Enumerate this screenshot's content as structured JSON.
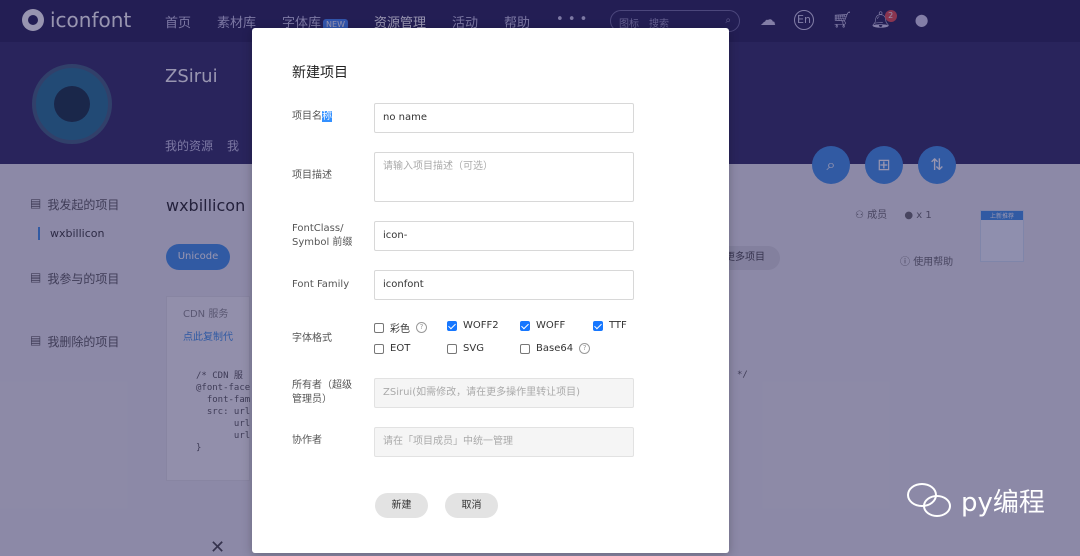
{
  "header": {
    "logo_text": "iconfont",
    "nav": [
      "首页",
      "素材库",
      "字体库",
      "资源管理",
      "活动",
      "帮助",
      "• • •"
    ],
    "nav_new_tag": "NEW",
    "search_scope": "图标",
    "search_placeholder": "搜索",
    "lang": "En",
    "notification_count": "2"
  },
  "hero": {
    "username": "ZSirui",
    "subnav": [
      "我的资源",
      "我"
    ]
  },
  "sidebar": {
    "items": [
      "我发起的项目",
      "我参与的项目",
      "我删除的项目"
    ],
    "current_project": "wxbillicon"
  },
  "main": {
    "project_title": "wxbillicon",
    "active_tab": "Unicode",
    "cdn_text": "CDN 服务",
    "cdn_link": "点此复制代",
    "code_lines": [
      "/* CDN 服",
      "@font-face",
      "  font-fam",
      "  src: url",
      "       url",
      "       url",
      "}"
    ],
    "code_end": "*/",
    "settings_button": "更多项目",
    "right_count": "x 1",
    "right_member": "成员",
    "help_link": "使用帮助",
    "right_card_tag": "上新推荐"
  },
  "modal": {
    "title": "新建项目",
    "name_label_plain": "项目名",
    "name_label_selected": "称",
    "name_value": "no name",
    "desc_label": "项目描述",
    "desc_placeholder": "请输入项目描述（可选）",
    "fontclass_label_line1": "FontClass/",
    "fontclass_label_line2": "Symbol 前缀",
    "fontclass_value": "icon-",
    "family_label": "Font Family",
    "family_value": "iconfont",
    "format_label": "字体格式",
    "formats": [
      {
        "label": "彩色",
        "checked": false,
        "help": true
      },
      {
        "label": "WOFF2",
        "checked": true,
        "help": false
      },
      {
        "label": "WOFF",
        "checked": true,
        "help": false
      },
      {
        "label": "TTF",
        "checked": true,
        "help": false
      },
      {
        "label": "EOT",
        "checked": false,
        "help": false
      },
      {
        "label": "SVG",
        "checked": false,
        "help": false
      },
      {
        "label": "Base64",
        "checked": false,
        "help": true
      }
    ],
    "owner_label_line1": "所有者（超级",
    "owner_label_line2": "管理员）",
    "owner_value": "ZSirui(如需修改，请在更多操作里转让项目)",
    "collab_label": "协作者",
    "collab_value": "请在「项目成员」中统一管理",
    "create_button": "新建",
    "cancel_button": "取消"
  },
  "watermark": {
    "text": "py编程"
  }
}
